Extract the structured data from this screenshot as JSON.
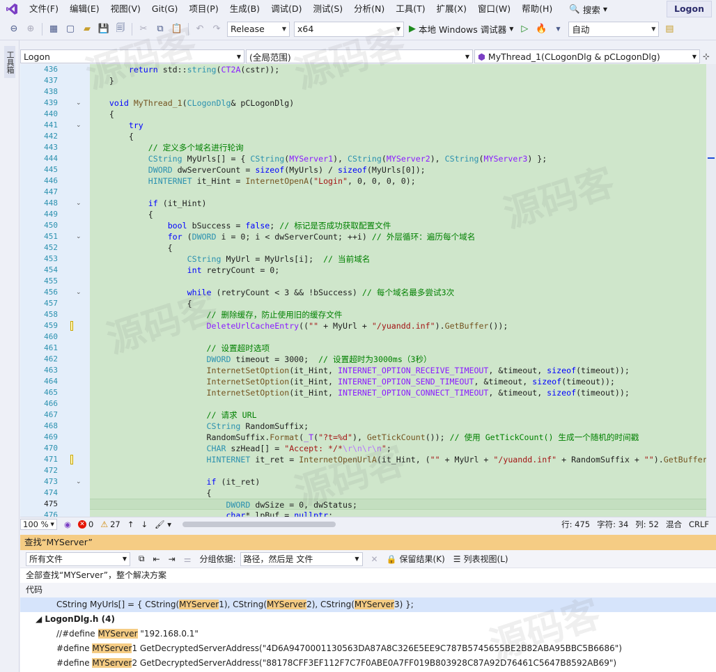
{
  "menu": {
    "items": [
      "文件(F)",
      "编辑(E)",
      "视图(V)",
      "Git(G)",
      "项目(P)",
      "生成(B)",
      "调试(D)",
      "测试(S)",
      "分析(N)",
      "工具(T)",
      "扩展(X)",
      "窗口(W)",
      "帮助(H)"
    ],
    "search_label": "搜索",
    "solution_name": "Logon"
  },
  "toolbar": {
    "config": "Release",
    "platform": "x64",
    "run_label": "本地 Windows 调试器",
    "auto_label": "自动"
  },
  "rail": {
    "tab_label": "工具箱"
  },
  "navbar": {
    "project": "Logon",
    "scope": "(全局范围)",
    "member": "MyThread_1(CLogonDlg & pCLogonDlg)"
  },
  "editor": {
    "lines": [
      {
        "n": "436",
        "html": "        <span class='kw'>return</span> std::<span class='ty'>string</span>(<span class='mc'>CT2A</span>(cstr));"
      },
      {
        "n": "437",
        "html": "    }"
      },
      {
        "n": "438",
        "html": ""
      },
      {
        "n": "439",
        "fold": true,
        "html": "    <span class='kw'>void</span> <span class='fn'>MyThread_1</span>(<span class='ty'>CLogonDlg</span>&amp; pCLogonDlg)"
      },
      {
        "n": "440",
        "html": "    {"
      },
      {
        "n": "441",
        "fold": true,
        "html": "        <span class='kw'>try</span>"
      },
      {
        "n": "442",
        "html": "        {"
      },
      {
        "n": "443",
        "html": "            <span class='cm'>// 定义多个域名进行轮询</span>"
      },
      {
        "n": "444",
        "html": "            <span class='ty'>CString</span> MyUrls[] = { <span class='ty'>CString</span>(<span class='mc'>MYServer1</span>), <span class='ty'>CString</span>(<span class='mc'>MYServer2</span>), <span class='ty'>CString</span>(<span class='mc'>MYServer3</span>) };"
      },
      {
        "n": "445",
        "html": "            <span class='ty'>DWORD</span> dwServerCount = <span class='kw'>sizeof</span>(MyUrls) / <span class='kw'>sizeof</span>(MyUrls[0]);"
      },
      {
        "n": "446",
        "html": "            <span class='ty'>HINTERNET</span> it_Hint = <span class='fn'>InternetOpenA</span>(<span class='st'>\"Login\"</span>, 0, 0, 0, 0);"
      },
      {
        "n": "447",
        "html": ""
      },
      {
        "n": "448",
        "fold": true,
        "html": "            <span class='kw'>if</span> (it_Hint)"
      },
      {
        "n": "449",
        "html": "            {"
      },
      {
        "n": "450",
        "html": "                <span class='kw'>bool</span> bSuccess = <span class='kw'>false</span>; <span class='cm'>// 标记是否成功获取配置文件</span>"
      },
      {
        "n": "451",
        "fold": true,
        "html": "                <span class='kw'>for</span> (<span class='ty'>DWORD</span> i = 0; i &lt; dwServerCount; ++i) <span class='cm'>// 外层循环：遍历每个域名</span>"
      },
      {
        "n": "452",
        "html": "                {"
      },
      {
        "n": "453",
        "html": "                    <span class='ty'>CString</span> MyUrl = MyUrls[i];  <span class='cm'>// 当前域名</span>"
      },
      {
        "n": "454",
        "html": "                    <span class='kw'>int</span> retryCount = 0;"
      },
      {
        "n": "455",
        "html": ""
      },
      {
        "n": "456",
        "fold": true,
        "html": "                    <span class='kw'>while</span> (retryCount &lt; 3 &amp;&amp; !bSuccess) <span class='cm'>// 每个域名最多尝试3次</span>"
      },
      {
        "n": "457",
        "html": "                    {"
      },
      {
        "n": "458",
        "html": "                        <span class='cm'>// 删除缓存，防止使用旧的缓存文件</span>"
      },
      {
        "n": "459",
        "mark": true,
        "html": "                        <span class='mc'>DeleteUrlCacheEntry</span>((<span class='st'>\"\"</span> + MyUrl + <span class='st'>\"/yuandd.inf\"</span>).<span class='fn'>GetBuffer</span>());"
      },
      {
        "n": "460",
        "html": ""
      },
      {
        "n": "461",
        "html": "                        <span class='cm'>// 设置超时选项</span>"
      },
      {
        "n": "462",
        "html": "                        <span class='ty'>DWORD</span> timeout = 3000;  <span class='cm'>// 设置超时为3000ms（3秒）</span>"
      },
      {
        "n": "463",
        "html": "                        <span class='fn'>InternetSetOption</span>(it_Hint, <span class='mc'>INTERNET_OPTION_RECEIVE_TIMEOUT</span>, &amp;timeout, <span class='kw'>sizeof</span>(timeout));"
      },
      {
        "n": "464",
        "html": "                        <span class='fn'>InternetSetOption</span>(it_Hint, <span class='mc'>INTERNET_OPTION_SEND_TIMEOUT</span>, &amp;timeout, <span class='kw'>sizeof</span>(timeout));"
      },
      {
        "n": "465",
        "html": "                        <span class='fn'>InternetSetOption</span>(it_Hint, <span class='mc'>INTERNET_OPTION_CONNECT_TIMEOUT</span>, &amp;timeout, <span class='kw'>sizeof</span>(timeout));"
      },
      {
        "n": "466",
        "html": ""
      },
      {
        "n": "467",
        "html": "                        <span class='cm'>// 请求 URL</span>"
      },
      {
        "n": "468",
        "html": "                        <span class='ty'>CString</span> RandomSuffix;"
      },
      {
        "n": "469",
        "html": "                        RandomSuffix.<span class='fn'>Format</span>(<span class='mc'>_T</span>(<span class='st'>\"?t=%d\"</span>), <span class='fn'>GetTickCount</span>()); <span class='cm'>// 使用 GetTickCount() 生成一个随机的时间戳</span>"
      },
      {
        "n": "470",
        "html": "                        <span class='ty'>CHAR</span> szHead[] = <span class='st'>\"Accept: */*</span><span class='es'>\\r\\n\\r\\n</span><span class='st'>\"</span>;"
      },
      {
        "n": "471",
        "mark": true,
        "html": "                        <span class='ty'>HINTERNET</span> it_ret = <span class='fn'>InternetOpenUrlA</span>(it_Hint, (<span class='st'>\"\"</span> + MyUrl + <span class='st'>\"/yuandd.inf\"</span> + RandomSuffix + <span class='st'>\"\"</span>).<span class='fn'>GetBuffer</span>()"
      },
      {
        "n": "472",
        "html": ""
      },
      {
        "n": "473",
        "fold": true,
        "html": "                        <span class='kw'>if</span> (it_ret)"
      },
      {
        "n": "474",
        "html": "                        {"
      },
      {
        "n": "475",
        "caret": true,
        "html": "                            <span class='ty'>DWORD</span> dwSize = 0, dwStatus;"
      },
      {
        "n": "476",
        "html": "                            <span class='kw'>char</span>* lpBuf = <span class='kw'>nullptr</span>;"
      }
    ]
  },
  "status": {
    "zoom": "100 %",
    "errors": "0",
    "warnings": "27",
    "line": "行: 475",
    "char": "字符: 34",
    "col": "列: 52",
    "mode": "混合",
    "eol": "CRLF"
  },
  "find": {
    "title": "查找“MYServer”",
    "scope": "所有文件",
    "group_label": "分组依据:",
    "group_value": "路径，然后是 文件",
    "keep_results": "保留结果(K)",
    "list_view": "列表视图(L)",
    "summary": "全部查找“MYServer”，整个解决方案",
    "header": "代码",
    "file_group": "LogonDlg.h (4)"
  },
  "colors": {
    "accent": "#2b2b6b",
    "find_highlight": "#f5cc84",
    "editor_bg": "#cfe6cb"
  }
}
